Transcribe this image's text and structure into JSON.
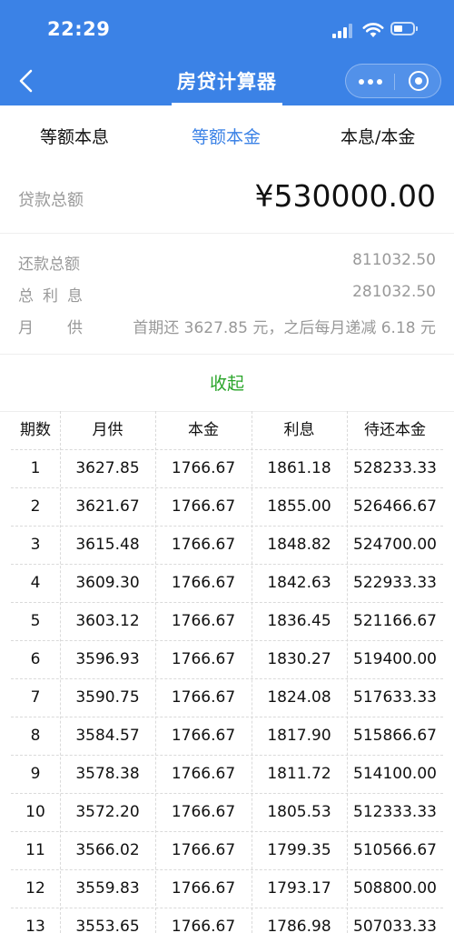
{
  "status_bar": {
    "time": "22:29"
  },
  "nav": {
    "title": "房贷计算器",
    "color": "#3b82e6"
  },
  "tabs": [
    {
      "label": "等额本息",
      "active": false
    },
    {
      "label": "等额本金",
      "active": true
    },
    {
      "label": "本息/本金",
      "active": false
    }
  ],
  "loan": {
    "principal_label": "贷款总额",
    "principal_value": "¥530000.00"
  },
  "summary": {
    "total_label": "还款总额",
    "total_value": "811032.50",
    "interest_label_1": "总",
    "interest_label_2": "利",
    "interest_label_3": "息",
    "interest_value": "281032.50",
    "monthly_label_1": "月",
    "monthly_label_2": "供",
    "monthly_value": "首期还 3627.85 元，之后每月递减 6.18 元"
  },
  "collapse_label": "收起",
  "table": {
    "headers": [
      "期数",
      "月供",
      "本金",
      "利息",
      "待还本金"
    ],
    "rows": [
      [
        "1",
        "3627.85",
        "1766.67",
        "1861.18",
        "528233.33"
      ],
      [
        "2",
        "3621.67",
        "1766.67",
        "1855.00",
        "526466.67"
      ],
      [
        "3",
        "3615.48",
        "1766.67",
        "1848.82",
        "524700.00"
      ],
      [
        "4",
        "3609.30",
        "1766.67",
        "1842.63",
        "522933.33"
      ],
      [
        "5",
        "3603.12",
        "1766.67",
        "1836.45",
        "521166.67"
      ],
      [
        "6",
        "3596.93",
        "1766.67",
        "1830.27",
        "519400.00"
      ],
      [
        "7",
        "3590.75",
        "1766.67",
        "1824.08",
        "517633.33"
      ],
      [
        "8",
        "3584.57",
        "1766.67",
        "1817.90",
        "515866.67"
      ],
      [
        "9",
        "3578.38",
        "1766.67",
        "1811.72",
        "514100.00"
      ],
      [
        "10",
        "3572.20",
        "1766.67",
        "1805.53",
        "512333.33"
      ],
      [
        "11",
        "3566.02",
        "1766.67",
        "1799.35",
        "510566.67"
      ],
      [
        "12",
        "3559.83",
        "1766.67",
        "1793.17",
        "508800.00"
      ],
      [
        "13",
        "3553.65",
        "1766.67",
        "1786.98",
        "507033.33"
      ]
    ]
  }
}
